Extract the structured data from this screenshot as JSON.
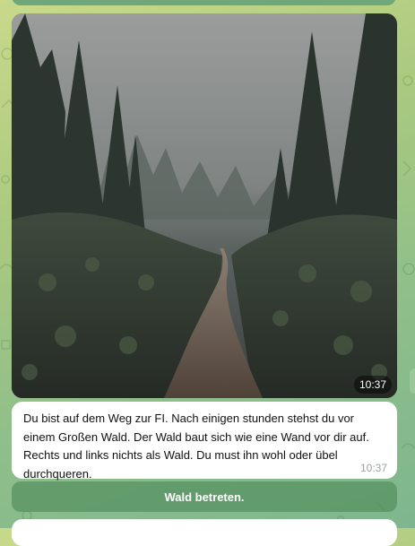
{
  "chat": {
    "photo_message": {
      "image_icon": "misty-forest-path-photo",
      "time": "10:37"
    },
    "text_message": {
      "text": "Du bist auf dem Weg zur FI. Nach einigen stunden stehst du vor einem Großen Wald. Der Wald baut sich wie eine Wand vor dir auf. Rechts und links nichts als Wald. Du must ihn wohl oder übel durchqueren.",
      "time": "10:37"
    },
    "keyboard": {
      "button_label": "Wald betreten."
    }
  },
  "colors": {
    "background_start": "#c9d98a",
    "background_end": "#7fb68e",
    "bubble": "#ffffff",
    "button": "#5b9a66"
  }
}
